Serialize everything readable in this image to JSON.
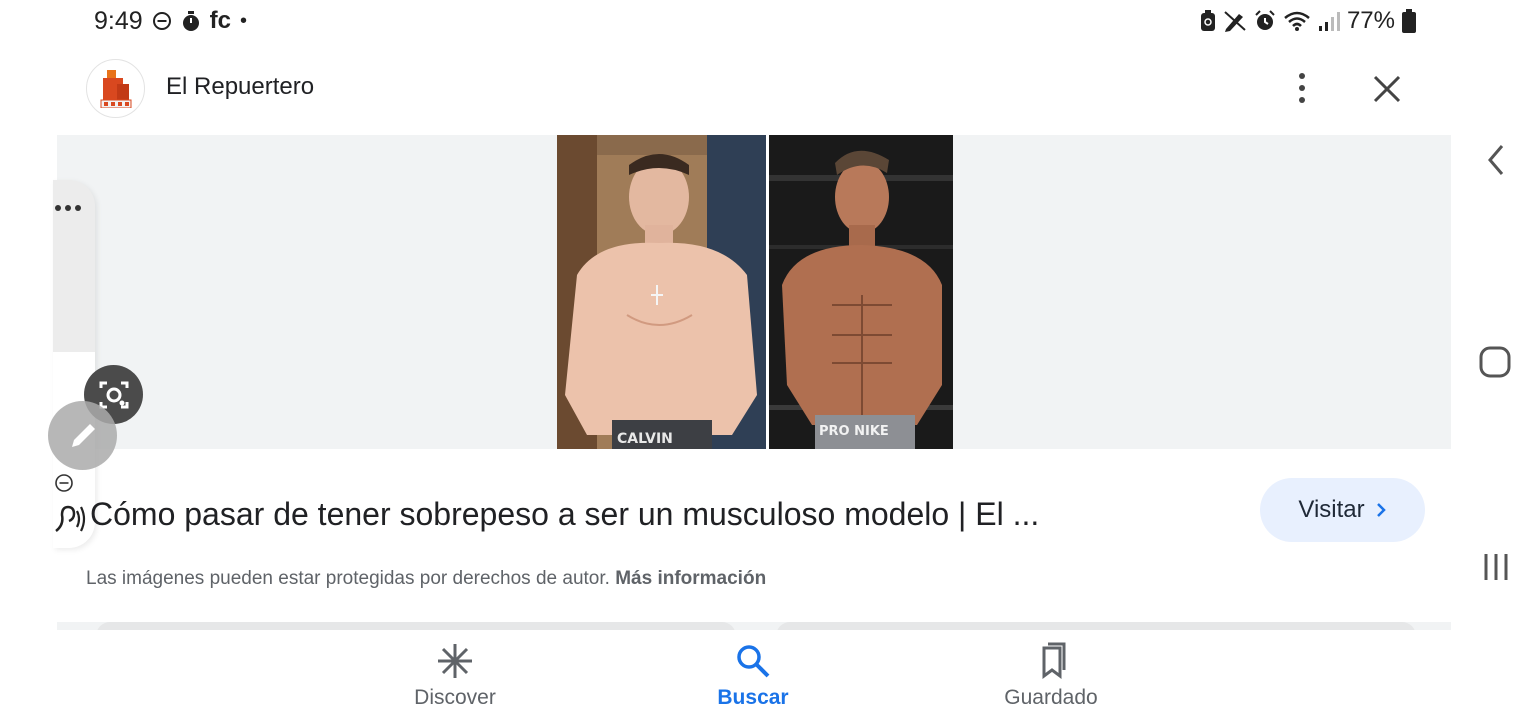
{
  "status_bar": {
    "time": "9:49",
    "carrier_text": "fc",
    "dot": "•",
    "battery_percent": "77%"
  },
  "header": {
    "site_name": "El Repuertero"
  },
  "result": {
    "title": "Cómo pasar de tener sobrepeso a ser un musculoso modelo | El ...",
    "visit_label": "Visitar",
    "copyright_text": "Las imágenes pueden estar protegidas por derechos de autor.",
    "more_info_label": "Más información"
  },
  "bottom_nav": {
    "items": [
      {
        "label": "Discover",
        "icon": "asterisk-icon",
        "active": false
      },
      {
        "label": "Buscar",
        "icon": "search-icon",
        "active": true
      },
      {
        "label": "Guardado",
        "icon": "bookmarks-icon",
        "active": false
      }
    ]
  },
  "colors": {
    "accent": "#1a73e8",
    "visit_bg": "#e8f0fe",
    "image_bg": "#f1f3f4"
  }
}
